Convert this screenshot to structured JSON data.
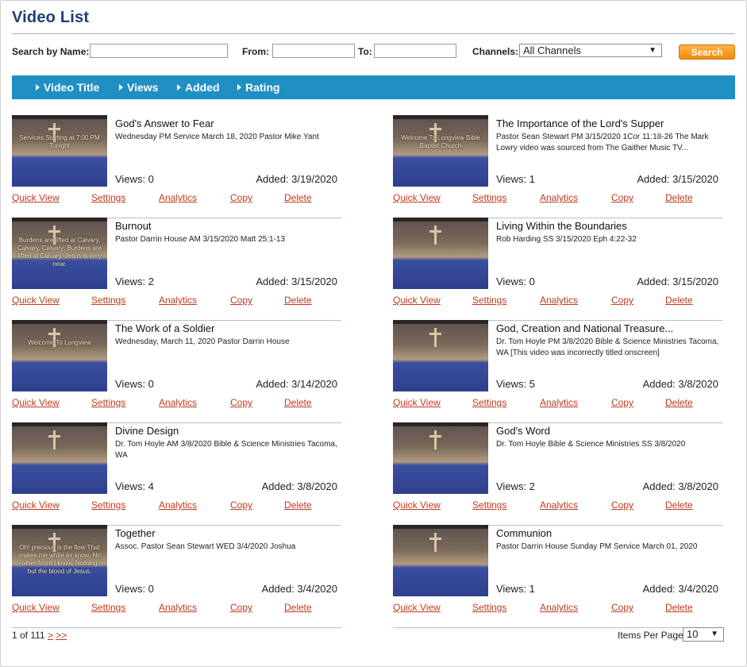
{
  "page_title": "Video List",
  "filters": {
    "search_label": "Search by Name:",
    "search_value": "",
    "from_label": "From:",
    "from_value": "",
    "to_label": "To:",
    "to_value": "",
    "channels_label": "Channels:",
    "channels_selected": "All Channels",
    "search_button": "Search"
  },
  "sort_bar": {
    "video_title": "Video Title",
    "views": "Views",
    "added": "Added",
    "rating": "Rating"
  },
  "action_labels": {
    "quick_view": "Quick View",
    "settings": "Settings",
    "analytics": "Analytics",
    "copy": "Copy",
    "delete": "Delete"
  },
  "videos": [
    {
      "title": "God's Answer to Fear",
      "description": "Wednesday PM Service March 18, 2020 Pastor Mike Yant",
      "views": "Views: 0",
      "added": "Added: 3/19/2020",
      "thumb_caption": "Services Starting at 7:00 PM Tonight"
    },
    {
      "title": "The Importance of the Lord's Supper",
      "description": "Pastor Sean Stewart PM 3/15/2020 1Cor 11:18-26 The Mark Lowry video was sourced from The Gaither Music TV...",
      "views": "Views: 1",
      "added": "Added: 3/15/2020",
      "thumb_caption": "Welcome To Longview Bible Baptist Church"
    },
    {
      "title": "Burnout",
      "description": "Pastor Darrin House AM 3/15/2020 Matt 25:1-13",
      "views": "Views: 2",
      "added": "Added: 3/15/2020",
      "thumb_caption": "Burdens are lifted at Calvary, Calvary, Calvary; Burdens are lifted at Calvary, Jesus is very near."
    },
    {
      "title": "Living Within the Boundaries",
      "description": "Rob Harding SS 3/15/2020 Eph 4:22-32",
      "views": "Views: 0",
      "added": "Added: 3/15/2020",
      "thumb_caption": ""
    },
    {
      "title": "The Work of a Soldier",
      "description": "Wednesday, March 11, 2020 Pastor Darrin House",
      "views": "Views: 0",
      "added": "Added: 3/14/2020",
      "thumb_caption": "Welcome To Longview"
    },
    {
      "title": "God, Creation and National Treasure...",
      "description": "Dr. Tom Hoyle PM 3/8/2020 Bible & Science Ministries Tacoma, WA [This video was incorrectly titled onscreen]",
      "views": "Views: 5",
      "added": "Added: 3/8/2020",
      "thumb_caption": ""
    },
    {
      "title": "Divine Design",
      "description": "Dr. Tom Hoyle AM 3/8/2020 Bible & Science Ministries Tacoma, WA",
      "views": "Views: 4",
      "added": "Added: 3/8/2020",
      "thumb_caption": ""
    },
    {
      "title": "God's Word",
      "description": "Dr. Tom Hoyle Bible & Science Ministries SS 3/8/2020",
      "views": "Views: 2",
      "added": "Added: 3/8/2020",
      "thumb_caption": ""
    },
    {
      "title": "Together",
      "description": "Assoc. Pastor Sean Stewart WED 3/4/2020 Joshua",
      "views": "Views: 0",
      "added": "Added: 3/4/2020",
      "thumb_caption": "Oh! precious is the flow That makes me white as snow; No other fount I know, Nothing but the blood of Jesus."
    },
    {
      "title": "Communion",
      "description": "Pastor Darrin House Sunday PM Service March 01, 2020",
      "views": "Views: 1",
      "added": "Added: 3/4/2020",
      "thumb_caption": ""
    }
  ],
  "pagination": {
    "page_info": "1 of 111",
    "next": ">",
    "last": ">>",
    "items_per_page_label": "Items Per Page",
    "items_per_page_value": "10"
  }
}
